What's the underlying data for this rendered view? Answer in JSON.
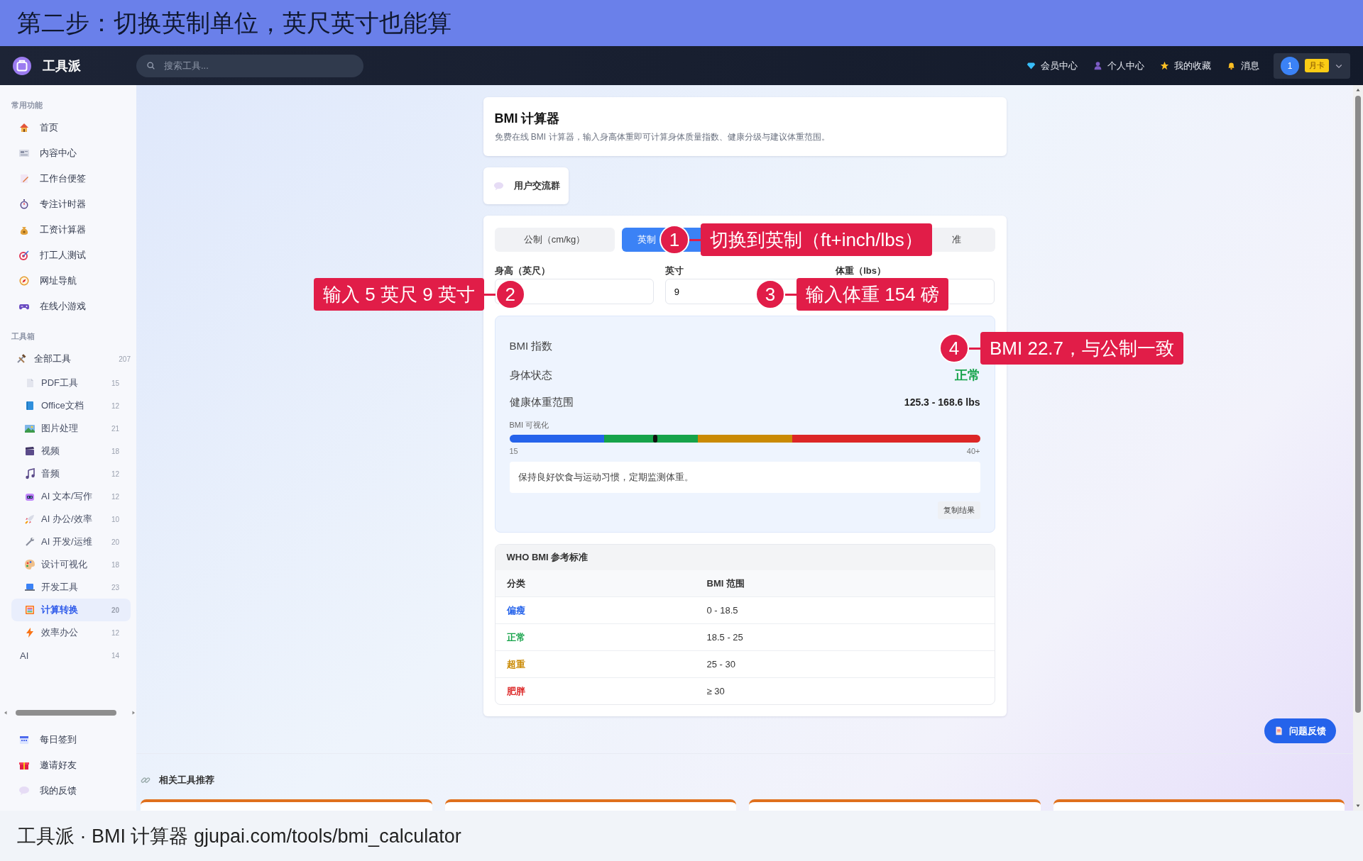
{
  "banner": {
    "title": "第二步：切换英制单位，英尺英寸也能算"
  },
  "header": {
    "logo": "工具派",
    "search": {
      "placeholder": "搜索工具..."
    },
    "nav": [
      {
        "label": "会员中心"
      },
      {
        "label": "个人中心"
      },
      {
        "label": "我的收藏"
      },
      {
        "label": "消息"
      }
    ],
    "user": {
      "avatar": "1",
      "badge": "月卡"
    }
  },
  "sidebar": {
    "sections": [
      {
        "title": "常用功能",
        "items": [
          {
            "label": "首页",
            "selected": false
          },
          {
            "label": "内容中心",
            "selected": false
          },
          {
            "label": "工作台便签",
            "selected": false
          },
          {
            "label": "专注计时器",
            "selected": false
          },
          {
            "label": "工资计算器",
            "selected": false
          },
          {
            "label": "打工人测试",
            "selected": false
          },
          {
            "label": "网址导航",
            "selected": false
          },
          {
            "label": "在线小游戏",
            "selected": false
          }
        ]
      },
      {
        "title": "工具箱",
        "items": [
          {
            "label": "全部工具",
            "count": "207",
            "selected": false,
            "children": [
              {
                "label": "PDF工具",
                "count": "15",
                "selected": false
              },
              {
                "label": "Office文档",
                "count": "12",
                "selected": false
              },
              {
                "label": "图片处理",
                "count": "21",
                "selected": false
              },
              {
                "label": "视频",
                "count": "18",
                "selected": false
              },
              {
                "label": "音频",
                "count": "12",
                "selected": false
              },
              {
                "label": "AI 文本/写作",
                "count": "12",
                "selected": false
              },
              {
                "label": "AI 办公/效率",
                "count": "10",
                "selected": false
              },
              {
                "label": "AI 开发/运维",
                "count": "20",
                "selected": false
              },
              {
                "label": "设计可视化",
                "count": "18",
                "selected": false
              },
              {
                "label": "开发工具",
                "count": "23",
                "selected": false
              },
              {
                "label": "计算转换",
                "count": "20",
                "selected": true
              },
              {
                "label": "效率办公",
                "count": "12",
                "selected": false
              },
              {
                "label": "AI",
                "count": "14",
                "selected": false
              }
            ]
          }
        ]
      }
    ],
    "footer_items": [
      {
        "label": "每日签到"
      },
      {
        "label": "邀请好友"
      },
      {
        "label": "我的反馈"
      }
    ]
  },
  "page": {
    "title": "BMI 计算器",
    "description": "免费在线 BMI 计算器，输入身高体重即可计算身体质量指数、健康分级与建议体重范围。",
    "group_button": "用户交流群"
  },
  "calculator": {
    "tabs": [
      {
        "label": "公制（cm/kg）",
        "selected": false
      },
      {
        "label": "英制",
        "selected": true
      },
      {
        "label": "准",
        "selected": false
      }
    ],
    "fields": [
      {
        "label": "身高（英尺）"
      },
      {
        "label": "英寸",
        "value": "9"
      },
      {
        "label": "体重（lbs）"
      }
    ],
    "result": {
      "rows": [
        {
          "kind": "plain",
          "label": "BMI 指数"
        },
        {
          "kind": "status",
          "label": "身体状态",
          "value": "正常"
        },
        {
          "kind": "value",
          "label": "健康体重范围",
          "value": "125.3 - 168.6 lbs"
        }
      ],
      "visual_label": "BMI 可视化",
      "scale": {
        "level": 0.31,
        "min": "15",
        "max": "40+"
      },
      "advice": "保持良好饮食与运动习惯，定期监测体重。",
      "copy_button": "复制结果"
    },
    "who_table": {
      "title": "WHO BMI 参考标准",
      "columns": [
        "分类",
        "BMI 范围"
      ],
      "rows": [
        {
          "category": "偏瘦",
          "range": "0 - 18.5",
          "color": "#2563eb"
        },
        {
          "category": "正常",
          "range": "18.5 - 25",
          "color": "#16a34a"
        },
        {
          "category": "超重",
          "range": "25 - 30",
          "color": "#ca8a04"
        },
        {
          "category": "肥胖",
          "range": "≥ 30",
          "color": "#dc2626"
        }
      ]
    }
  },
  "feedback_button": "问题反馈",
  "related": {
    "title": "相关工具推荐",
    "cards": [
      {
        "kind": "card"
      },
      {
        "kind": "card"
      },
      {
        "kind": "card"
      },
      {
        "kind": "card"
      }
    ]
  },
  "annotations": [
    {
      "number": "1",
      "text": "切换到英制（ft+inch/lbs）"
    },
    {
      "number": "2",
      "text": "输入 5 英尺 9 英寸"
    },
    {
      "number": "3",
      "text": "输入体重 154 磅"
    },
    {
      "number": "4",
      "text": "BMI 22.7，与公制一致"
    }
  ],
  "caption": "工具派 · BMI 计算器 gjupai.com/tools/bmi_calculator"
}
